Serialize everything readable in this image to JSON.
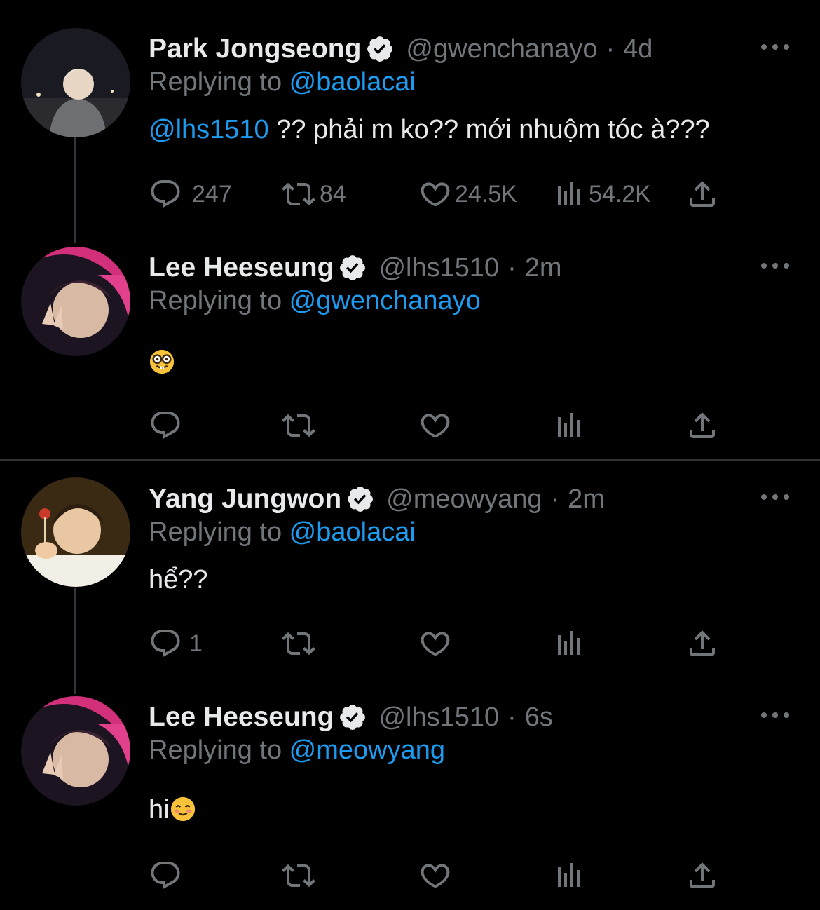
{
  "tweets": [
    {
      "name": "Park Jongseong",
      "handle": "@gwenchanayo",
      "dot": "·",
      "time": "4d",
      "replying_prefix": "Replying to ",
      "replying_to": "@baolacai",
      "body_mention": "@lhs1510",
      "body_text": " ?? phải m ko?? mới nhuộm tóc à???",
      "replies": "247",
      "retweets": "84",
      "likes": "24.5K",
      "views": "54.2K"
    },
    {
      "name": "Lee Heeseung",
      "handle": "@lhs1510",
      "dot": "·",
      "time": "2m",
      "replying_prefix": "Replying to ",
      "replying_to": "@gwenchanayo",
      "body_emoji": "nerd-face"
    },
    {
      "name": "Yang Jungwon",
      "handle": "@meowyang",
      "dot": "·",
      "time": "2m",
      "replying_prefix": "Replying to ",
      "replying_to": "@baolacai",
      "body_text": "hể??",
      "replies": "1"
    },
    {
      "name": "Lee Heeseung",
      "handle": "@lhs1510",
      "dot": "·",
      "time": "6s",
      "replying_prefix": "Replying to ",
      "replying_to": "@meowyang",
      "body_text": "hi",
      "body_emoji": "smiling-face"
    }
  ],
  "colors": {
    "background": "#000000",
    "text": "#e7e9ea",
    "muted": "#71767b",
    "accent": "#1d9bf0"
  }
}
